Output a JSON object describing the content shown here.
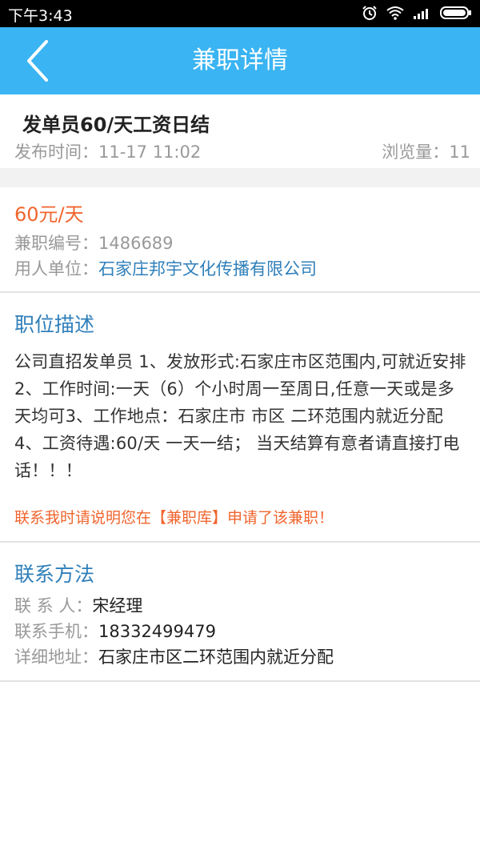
{
  "status_bar": {
    "time": "下午3:43"
  },
  "app_bar": {
    "title": "兼职详情"
  },
  "job": {
    "title": "发单员60/天工资日结",
    "publish_time_label": "发布时间：",
    "publish_time": "11-17 11:02",
    "views_label": "浏览量：",
    "views": "11",
    "wage": "60元/天",
    "id_label": "兼职编号：",
    "id": "1486689",
    "employer_label": "用人单位：",
    "employer": "石家庄邦宇文化传播有限公司"
  },
  "description": {
    "heading": "职位描述",
    "text": "公司直招发单员 1、发放形式:石家庄市区范围内,可就近安排2、工作时间:一天（6）个小时周一至周日,任意一天或是多天均可3、工作地点：石家庄市 市区 二环范围内就近分配4、工资待遇:60/天 一天一结； 当天结算有意者请直接打电话！！！",
    "notice": "联系我时请说明您在【兼职库】申请了该兼职！"
  },
  "contact": {
    "heading": "联系方法",
    "person_label": "联 系 人：",
    "person": "宋经理",
    "phone_label": "联系手机：",
    "phone": "18332499479",
    "address_label": "详细地址：",
    "address": "石家庄市区二环范围内就近分配"
  },
  "colors": {
    "app_bar": "#3ab4f2",
    "accent_orange": "#f0652e",
    "link_blue": "#2f7fba"
  },
  "icons": [
    "alarm-icon",
    "wifi-icon",
    "signal-icon",
    "battery-icon",
    "back-arrow-icon"
  ]
}
